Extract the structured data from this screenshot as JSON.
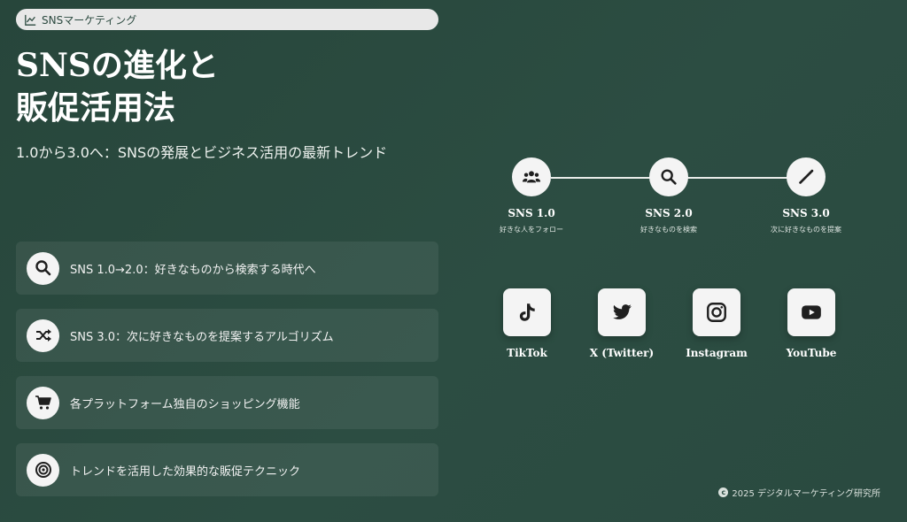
{
  "header": {
    "tag_label": "SNSマーケティング",
    "title_line1": "SNSの進化と",
    "title_line2": "販促活用法",
    "subtitle": "1.0から3.0へ：SNSの発展とビジネス活用の最新トレンド"
  },
  "features": [
    {
      "icon": "search-icon",
      "text": "SNS 1.0→2.0：好きなものから検索する時代へ"
    },
    {
      "icon": "shuffle-icon",
      "text": "SNS 3.0：次に好きなものを提案するアルゴリズム"
    },
    {
      "icon": "cart-icon",
      "text": "各プラットフォーム独自のショッピング機能"
    },
    {
      "icon": "target-icon",
      "text": "トレンドを活用した効果的な販促テクニック"
    }
  ],
  "timeline": [
    {
      "icon": "users-icon",
      "name": "SNS 1.0",
      "desc": "好きな人をフォロー"
    },
    {
      "icon": "search-icon",
      "name": "SNS 2.0",
      "desc": "好きなものを検索"
    },
    {
      "icon": "magic-wand-icon",
      "name": "SNS 3.0",
      "desc": "次に好きなものを提案"
    }
  ],
  "platforms": [
    {
      "icon": "tiktok-icon",
      "label": "TikTok"
    },
    {
      "icon": "twitter-icon",
      "label": "X (Twitter)"
    },
    {
      "icon": "instagram-icon",
      "label": "Instagram"
    },
    {
      "icon": "youtube-icon",
      "label": "YouTube"
    }
  ],
  "footer": {
    "copyright": "2025 デジタルマーケティング研究所"
  },
  "colors": {
    "background": "#2c4d42",
    "icon_fill": "#1f1f1f",
    "card": "#f4f4f4"
  }
}
